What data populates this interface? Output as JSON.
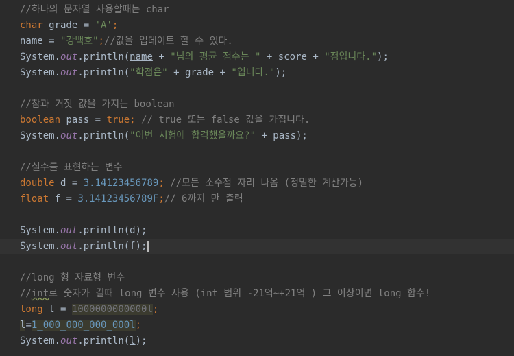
{
  "editor": {
    "lines": [
      [
        {
          "t": "//하나의 문자열 사용할때는 char",
          "c": "comment"
        }
      ],
      [
        {
          "t": "char",
          "c": "keyword"
        },
        {
          "t": " grade = ",
          "c": "ident"
        },
        {
          "t": "'A'",
          "c": "string"
        },
        {
          "t": ";",
          "c": "keyword"
        }
      ],
      [
        {
          "t": "name",
          "c": "ident underline"
        },
        {
          "t": " = ",
          "c": "ident"
        },
        {
          "t": "\"강백호\"",
          "c": "string"
        },
        {
          "t": ";",
          "c": "keyword"
        },
        {
          "t": "//값을 업데이트 할 수 있다.",
          "c": "comment"
        }
      ],
      [
        {
          "t": "System.",
          "c": "ident"
        },
        {
          "t": "out",
          "c": "static"
        },
        {
          "t": ".println(",
          "c": "ident"
        },
        {
          "t": "name",
          "c": "ident underline"
        },
        {
          "t": " + ",
          "c": "ident"
        },
        {
          "t": "\"님의 평균 점수는 \"",
          "c": "string"
        },
        {
          "t": " + score + ",
          "c": "ident"
        },
        {
          "t": "\"점입니다.\"",
          "c": "string"
        },
        {
          "t": ");",
          "c": "ident"
        }
      ],
      [
        {
          "t": "System.",
          "c": "ident"
        },
        {
          "t": "out",
          "c": "static"
        },
        {
          "t": ".println(",
          "c": "ident"
        },
        {
          "t": "\"학점은\"",
          "c": "string"
        },
        {
          "t": " + grade + ",
          "c": "ident"
        },
        {
          "t": "\"입니다.\"",
          "c": "string"
        },
        {
          "t": ");",
          "c": "ident"
        }
      ],
      [],
      [
        {
          "t": "//참과 거짓 값을 가지는 boolean",
          "c": "comment"
        }
      ],
      [
        {
          "t": "boolean",
          "c": "keyword"
        },
        {
          "t": " pass = ",
          "c": "ident"
        },
        {
          "t": "true",
          "c": "keyword"
        },
        {
          "t": "; ",
          "c": "keyword"
        },
        {
          "t": "// true 또는 false 값을 가집니다.",
          "c": "comment"
        }
      ],
      [
        {
          "t": "System.",
          "c": "ident"
        },
        {
          "t": "out",
          "c": "static"
        },
        {
          "t": ".println(",
          "c": "ident"
        },
        {
          "t": "\"이번 시험에 합격했을까요?\"",
          "c": "string"
        },
        {
          "t": " + pass);",
          "c": "ident"
        }
      ],
      [],
      [
        {
          "t": "//실수를 표현하는 변수",
          "c": "comment"
        }
      ],
      [
        {
          "t": "double",
          "c": "keyword"
        },
        {
          "t": " d = ",
          "c": "ident"
        },
        {
          "t": "3.14123456789",
          "c": "number"
        },
        {
          "t": "; ",
          "c": "keyword"
        },
        {
          "t": "//모든 소수점 자리 나옴 (정밀한 계산가능)",
          "c": "comment"
        }
      ],
      [
        {
          "t": "float",
          "c": "keyword"
        },
        {
          "t": " f = ",
          "c": "ident"
        },
        {
          "t": "3.14123456789F",
          "c": "number"
        },
        {
          "t": ";",
          "c": "keyword"
        },
        {
          "t": "// 6까지 만 출력",
          "c": "comment"
        }
      ],
      [],
      [
        {
          "t": "System.",
          "c": "ident"
        },
        {
          "t": "out",
          "c": "static"
        },
        {
          "t": ".println(d);",
          "c": "ident"
        }
      ],
      [
        {
          "t": "System.",
          "c": "ident"
        },
        {
          "t": "out",
          "c": "static"
        },
        {
          "t": ".println(f);",
          "c": "ident"
        },
        {
          "caret": true
        }
      ],
      [],
      [
        {
          "t": "//long 형 자료형 변수",
          "c": "comment"
        }
      ],
      [
        {
          "t": "//",
          "c": "comment"
        },
        {
          "t": "int",
          "c": "comment wavy"
        },
        {
          "t": "로 숫자가 길때 long 변수 사용 (int 범위 -21억~+21억 ) 그 이상이면 long 함수!",
          "c": "comment"
        }
      ],
      [
        {
          "t": "long",
          "c": "keyword"
        },
        {
          "t": " ",
          "c": "ident"
        },
        {
          "t": "l",
          "c": "ident underline"
        },
        {
          "t": " = ",
          "c": "ident"
        },
        {
          "t": "1000000000000l",
          "c": "unused"
        },
        {
          "t": ";",
          "c": "keyword"
        }
      ],
      [
        {
          "t": "l",
          "c": "ident hl"
        },
        {
          "t": "=",
          "c": "ident"
        },
        {
          "t": "1_000_000_000_000l",
          "c": "number hl"
        },
        {
          "t": ";",
          "c": "keyword"
        }
      ],
      [
        {
          "t": "System.",
          "c": "ident"
        },
        {
          "t": "out",
          "c": "static"
        },
        {
          "t": ".println(",
          "c": "ident"
        },
        {
          "t": "l",
          "c": "ident underline"
        },
        {
          "t": ");",
          "c": "ident"
        }
      ]
    ],
    "current_line": 15
  }
}
